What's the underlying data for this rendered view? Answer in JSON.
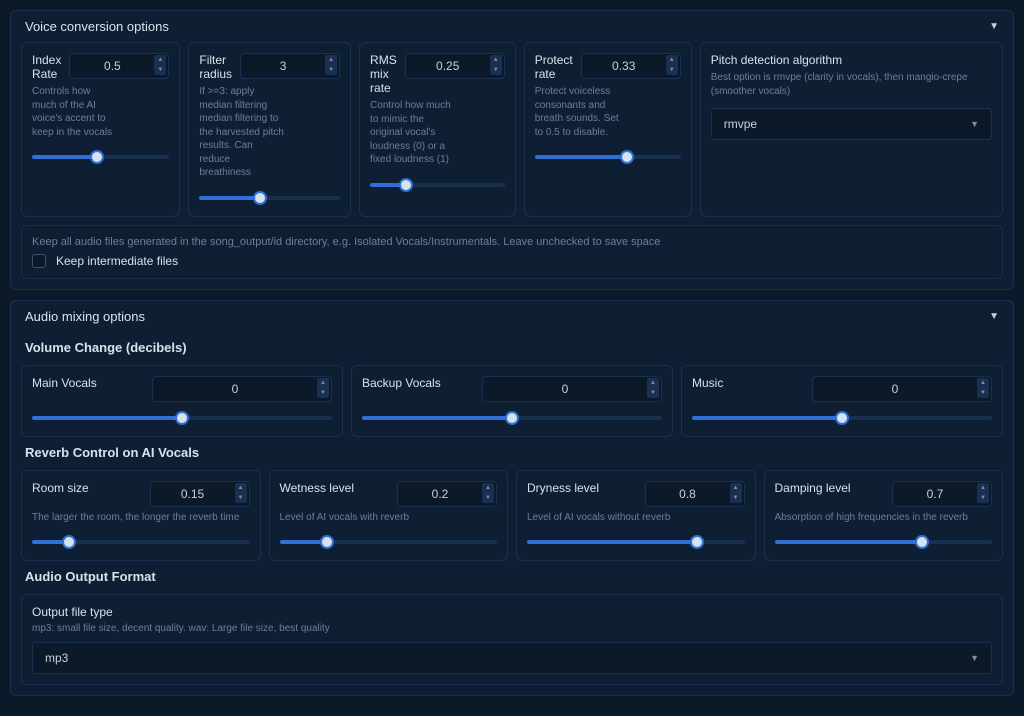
{
  "voiceConversion": {
    "title": "Voice conversion options",
    "indexRate": {
      "label": "Index Rate",
      "value": "0.5",
      "desc": "Controls how much of the AI voice's accent to keep in the vocals",
      "percent": 47
    },
    "filterRadius": {
      "label": "Filter radius",
      "value": "3",
      "desc": "If >=3: apply median filtering median filtering to the harvested pitch results. Can reduce breathiness",
      "percent": 43
    },
    "rmsMix": {
      "label": "RMS mix rate",
      "value": "0.25",
      "desc": "Control how much to mimic the original vocal's loudness (0) or a fixed loudness (1)",
      "percent": 27
    },
    "protect": {
      "label": "Protect rate",
      "value": "0.33",
      "desc": "Protect voiceless consonants and breath sounds. Set to 0.5 to disable.",
      "percent": 63
    },
    "pitch": {
      "label": "Pitch detection algorithm",
      "desc": "Best option is rmvpe (clarity in vocals), then mangio-crepe (smoother vocals)",
      "value": "rmvpe"
    },
    "keepFiles": {
      "desc": "Keep all audio files generated in the song_output/id directory, e.g. Isolated Vocals/Instrumentals. Leave unchecked to save space",
      "label": "Keep intermediate files"
    }
  },
  "audioMixing": {
    "title": "Audio mixing options",
    "volumeTitle": "Volume Change (decibels)",
    "mainVocals": {
      "label": "Main Vocals",
      "value": "0",
      "percent": 50
    },
    "backupVocals": {
      "label": "Backup Vocals",
      "value": "0",
      "percent": 50
    },
    "music": {
      "label": "Music",
      "value": "0",
      "percent": 50
    },
    "reverbTitle": "Reverb Control on AI Vocals",
    "roomSize": {
      "label": "Room size",
      "value": "0.15",
      "desc": "The larger the room, the longer the reverb time",
      "percent": 17
    },
    "wetness": {
      "label": "Wetness level",
      "value": "0.2",
      "desc": "Level of AI vocals with reverb",
      "percent": 22
    },
    "dryness": {
      "label": "Dryness level",
      "value": "0.8",
      "desc": "Level of AI vocals without reverb",
      "percent": 78
    },
    "damping": {
      "label": "Damping level",
      "value": "0.7",
      "desc": "Absorption of high frequencies in the reverb",
      "percent": 68
    },
    "outputTitle": "Audio Output Format",
    "outputType": {
      "label": "Output file type",
      "desc": "mp3: small file size, decent quality. wav: Large file size, best quality",
      "value": "mp3"
    }
  }
}
